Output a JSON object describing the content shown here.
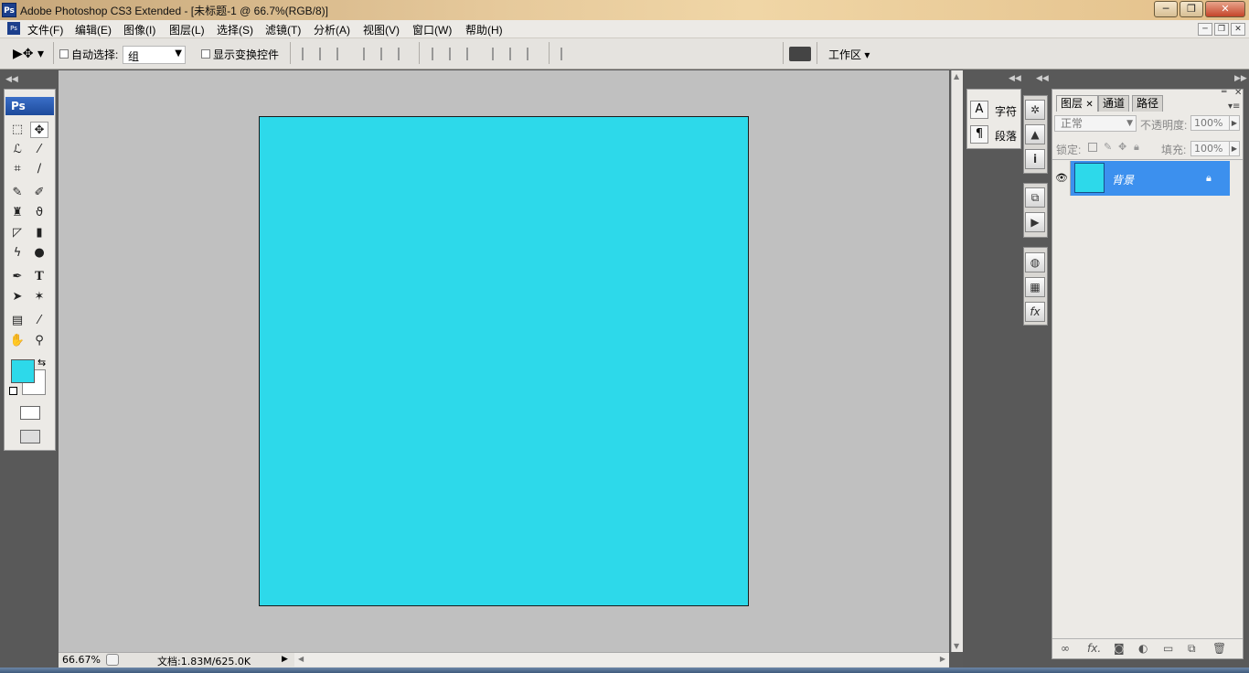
{
  "window": {
    "app_icon": "Ps",
    "title": "Adobe Photoshop CS3 Extended - [未标题-1 @ 66.7%(RGB/8)]",
    "controls": [
      "─",
      "❐",
      "✕"
    ]
  },
  "menubar": {
    "items": [
      "文件(F)",
      "编辑(E)",
      "图像(I)",
      "图层(L)",
      "选择(S)",
      "滤镜(T)",
      "分析(A)",
      "视图(V)",
      "窗口(W)",
      "帮助(H)"
    ],
    "mdi_controls": [
      "─",
      "❐",
      "✕"
    ]
  },
  "options": {
    "auto_select_label": "自动选择:",
    "auto_select_value": "组",
    "show_transform_label": "显示变换控件",
    "workspace_label": "工作区"
  },
  "toolbox": {
    "header": "Ps",
    "foreground_color": "#2dd9ea",
    "background_color": "#ffffff"
  },
  "document": {
    "fill_color": "#2dd9ea"
  },
  "status": {
    "zoom": "66.67%",
    "doc_info": "文档:1.83M/625.0K"
  },
  "char_panel": {
    "items": [
      {
        "icon": "A",
        "label": "字符"
      },
      {
        "icon": "¶",
        "label": "段落"
      }
    ]
  },
  "layers_panel": {
    "tabs": [
      "图层",
      "通道",
      "路径"
    ],
    "blend_mode": "正常",
    "opacity_label": "不透明度:",
    "opacity_value": "100%",
    "lock_label": "锁定:",
    "fill_label": "填充:",
    "fill_value": "100%",
    "layers": [
      {
        "name": "背景",
        "visible": true,
        "locked": true
      }
    ],
    "footer_icons": [
      "link-icon",
      "fx-icon",
      "mask-icon",
      "adjustment-icon",
      "group-icon",
      "new-layer-icon",
      "trash-icon"
    ]
  }
}
